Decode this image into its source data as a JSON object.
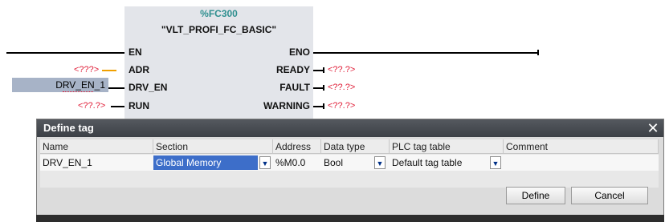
{
  "block": {
    "number": "%FC300",
    "name": "\"VLT_PROFI_FC_BASIC\"",
    "inputs": [
      "EN",
      "ADR",
      "DRV_EN",
      "RUN"
    ],
    "outputs": [
      "ENO",
      "READY",
      "FAULT",
      "WARNING"
    ]
  },
  "operands": {
    "adr": "<???>",
    "drv_en": "DRV_EN_1",
    "run": "<??.?>",
    "ready": "<??.?>",
    "fault": "<??.?>",
    "warning": "<??.?>"
  },
  "dialog": {
    "title": "Define tag",
    "close_icon": "close-icon",
    "columns": [
      "Name",
      "Section",
      "Address",
      "Data type",
      "PLC tag table",
      "Comment"
    ],
    "row": {
      "name": "DRV_EN_1",
      "section": "Global Memory",
      "address": "%M0.0",
      "data_type": "Bool",
      "plc_tag_table": "Default tag table",
      "comment": ""
    },
    "buttons": {
      "define": "Define",
      "cancel": "Cancel"
    }
  },
  "colors": {
    "block_bg": "#e3e5ea",
    "block_number": "#2f8f8f",
    "invalid_operand": "#e0203a",
    "wire_orange": "#f0a000",
    "selection": "#3d6ec9",
    "dialog_title": "#3c4046"
  }
}
